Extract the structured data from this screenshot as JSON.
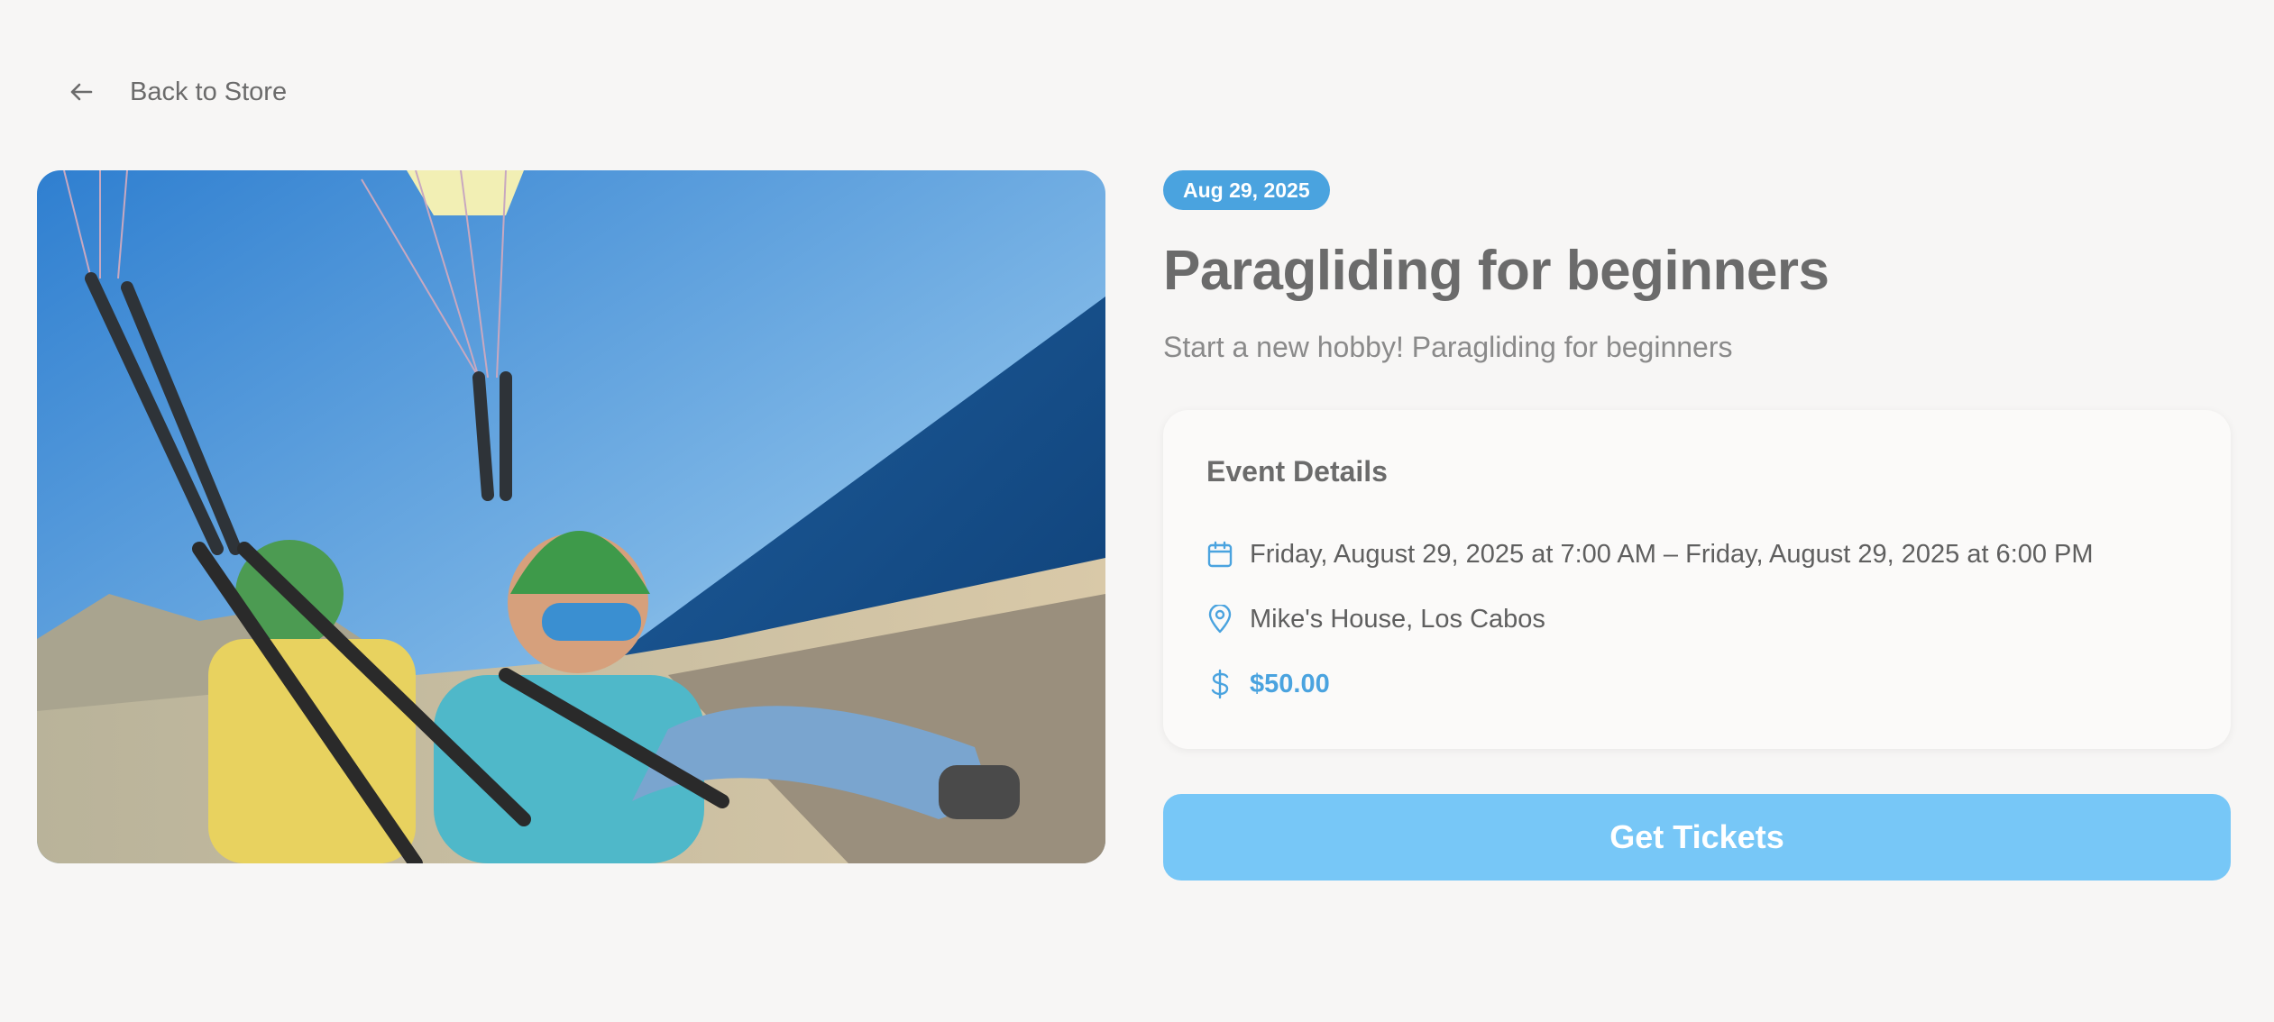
{
  "nav": {
    "back_label": "Back to Store",
    "back_icon": "arrow-left-icon"
  },
  "event": {
    "date_badge": "Aug 29, 2025",
    "title": "Paragliding for beginners",
    "subtitle": "Start a new hobby! Paragliding for beginners",
    "image_description_icon": "event-photo"
  },
  "details": {
    "heading": "Event Details",
    "datetime": "Friday, August 29, 2025 at 7:00 AM – Friday, August 29, 2025 at 6:00 PM",
    "location": "Mike's House, Los Cabos",
    "price": "$50.00",
    "icons": {
      "datetime": "calendar-icon",
      "location": "map-pin-icon",
      "price": "dollar-icon"
    }
  },
  "cta": {
    "label": "Get Tickets"
  },
  "colors": {
    "accent": "#4aa3df",
    "button": "#77c7f7",
    "background": "#f7f6f5"
  }
}
